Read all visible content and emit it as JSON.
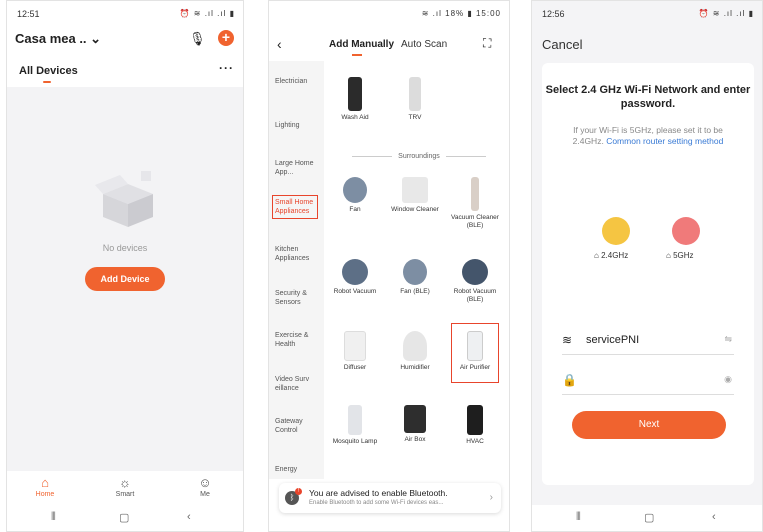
{
  "panel1": {
    "status_time": "12:51",
    "status_icons": "⏰ ≋ .ıl .ıl ▮",
    "home_title": "Casa mea ..",
    "tab_all": "All Devices",
    "more": "···",
    "empty_text": "No devices",
    "add_button": "Add Device",
    "nav": [
      {
        "label": "Home",
        "icon": "home-icon"
      },
      {
        "label": "Smart",
        "icon": "sun-icon"
      },
      {
        "label": "Me",
        "icon": "user-icon"
      }
    ],
    "accent": "#f0632f"
  },
  "panel2": {
    "status": "≋ .ıl 18% ▮ 15:00",
    "tab_manual": "Add Manually",
    "tab_scan": "Auto Scan",
    "categories": [
      "Electrician",
      "Lighting",
      "Large Home App...",
      "Small Home Appliances",
      "Kitchen Appliances",
      "Security & Sensors",
      "Exercise & Health",
      "Video Surv eillance",
      "Gateway Control",
      "Energy"
    ],
    "section_title": "Surroundings",
    "top_items": [
      "Wash Aid",
      "TRV"
    ],
    "items": [
      "Fan",
      "Window Cleaner",
      "Vacuum Cleaner (BLE)",
      "Robot Vacuum",
      "Fan (BLE)",
      "Robot Vacuum (BLE)",
      "Diffuser",
      "Humidifier",
      "Air Purifier",
      "Mosquito Lamp",
      "Air Box",
      "HVAC"
    ],
    "bt_title": "You are advised to enable Bluetooth.",
    "bt_sub": "Enable Bluetooth to add some Wi-Fi devices eas...",
    "bt_badge": "!"
  },
  "panel3": {
    "status_time": "12:56",
    "status_icons": "⏰ ≋ .ıl .ıl ▮",
    "cancel": "Cancel",
    "title": "Select 2.4 GHz Wi-Fi Network and enter password.",
    "hint_prefix": "If your Wi-Fi is 5GHz, please set it to be 2.4GHz.",
    "hint_link": "Common router setting method",
    "band_24": "2.4GHz",
    "band_5": "5GHz",
    "ssid": "servicePNI",
    "next": "Next"
  }
}
